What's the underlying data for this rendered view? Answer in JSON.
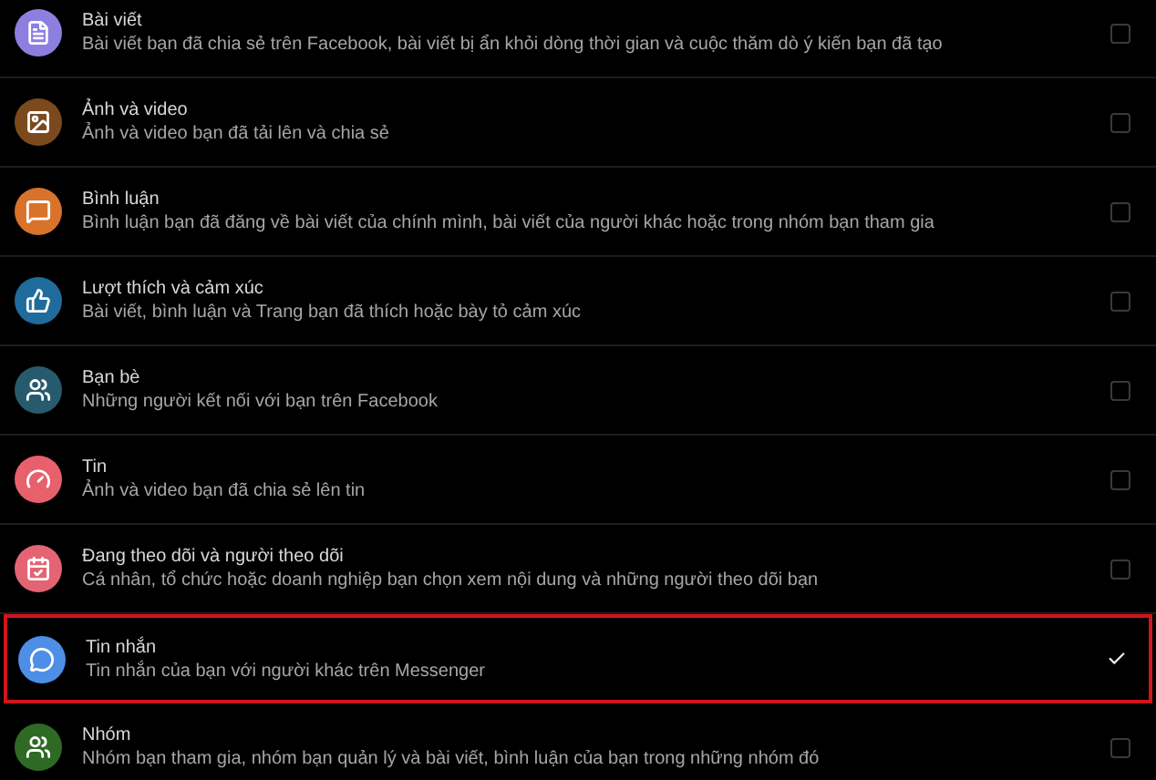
{
  "categories": [
    {
      "title": "Bài viết",
      "description": "Bài viết bạn đã chia sẻ trên Facebook, bài viết bị ẩn khỏi dòng thời gian và cuộc thăm dò ý kiến bạn đã tạo",
      "kind": "posts",
      "color": "#8c7fe0",
      "checked": false,
      "highlighted": false
    },
    {
      "title": "Ảnh và video",
      "description": "Ảnh và video bạn đã tải lên và chia sẻ",
      "kind": "photos",
      "color": "#7a4a1e",
      "checked": false,
      "highlighted": false
    },
    {
      "title": "Bình luận",
      "description": "Bình luận bạn đã đăng về bài viết của chính mình, bài viết của người khác hoặc trong nhóm bạn tham gia",
      "kind": "comments",
      "color": "#d9722a",
      "checked": false,
      "highlighted": false
    },
    {
      "title": "Lượt thích và cảm xúc",
      "description": "Bài viết, bình luận và Trang bạn đã thích hoặc bày tỏ cảm xúc",
      "kind": "likes",
      "color": "#1f6c9c",
      "checked": false,
      "highlighted": false
    },
    {
      "title": "Bạn bè",
      "description": "Những người kết nối với bạn trên Facebook",
      "kind": "friends",
      "color": "#285a6e",
      "checked": false,
      "highlighted": false
    },
    {
      "title": "Tin",
      "description": "Ảnh và video bạn đã chia sẻ lên tin",
      "kind": "stories",
      "color": "#e8606c",
      "checked": false,
      "highlighted": false
    },
    {
      "title": "Đang theo dõi và người theo dõi",
      "description": "Cá nhân, tổ chức hoặc doanh nghiệp bạn chọn xem nội dung và những người theo dõi bạn",
      "kind": "following",
      "color": "#e46473",
      "checked": false,
      "highlighted": false
    },
    {
      "title": "Tin nhắn",
      "description": "Tin nhắn của bạn với người khác trên Messenger",
      "kind": "messages",
      "color": "#4d8ee6",
      "checked": true,
      "highlighted": true
    },
    {
      "title": "Nhóm",
      "description": "Nhóm bạn tham gia, nhóm bạn quản lý và bài viết, bình luận của bạn trong những nhóm đó",
      "kind": "groups",
      "color": "#2f6a25",
      "checked": false,
      "highlighted": false
    }
  ]
}
